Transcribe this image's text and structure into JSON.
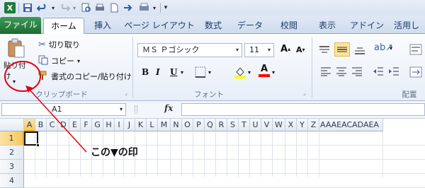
{
  "qat": {
    "logo": "X",
    "items": [
      "save-icon",
      "undo-icon",
      "redo-icon",
      "print-preview-icon",
      "new-icon",
      "open-icon",
      "arrow-icon",
      "customize-icon"
    ]
  },
  "tabs": [
    "ファイル",
    "ホーム",
    "挿入",
    "ページ レイアウト",
    "数式",
    "データ",
    "校閲",
    "表示",
    "アドイン",
    "活用し"
  ],
  "clipboard": {
    "paste_label": "貼り付け",
    "cut_label": "切り取り",
    "copy_label": "コピー",
    "format_painter_label": "書式のコピー/貼り付け",
    "group_label": "クリップボード"
  },
  "font": {
    "name": "ＭＳ Ｐゴシック",
    "size": "11",
    "bold": "B",
    "italic": "I",
    "underline": "U",
    "grow": "A",
    "shrink": "A",
    "group_label": "フォント",
    "fill_color": "#ffff00",
    "font_color": "#ff0000"
  },
  "alignment": {
    "group_label": "配置"
  },
  "formula_bar": {
    "name_box": "A1",
    "fx": "fx",
    "value": ""
  },
  "grid": {
    "columns": [
      "A",
      "B",
      "C",
      "D",
      "E",
      "F",
      "G",
      "H",
      "I",
      "J",
      "K",
      "L",
      "M",
      "N",
      "O",
      "P",
      "Q",
      "R",
      "S",
      "T",
      "U",
      "V",
      "W",
      "X",
      "Y",
      "Z",
      "AAAEACADAEA"
    ],
    "rows": [
      "1",
      "2",
      "3",
      "4"
    ]
  },
  "annotation": {
    "text": "この▼の印",
    "color": "#e3000f"
  }
}
